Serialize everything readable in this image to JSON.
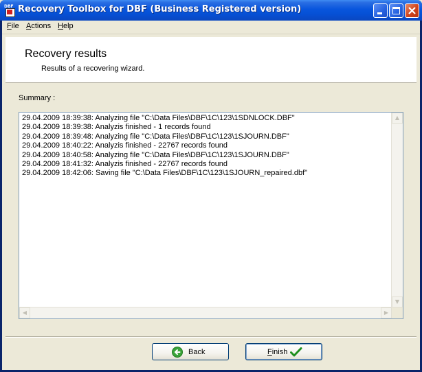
{
  "window": {
    "title": "Recovery Toolbox for DBF (Business Registered version)",
    "icon_label": "DBF",
    "controls": [
      "minimize-icon",
      "maximize-icon",
      "close-icon"
    ]
  },
  "menu": {
    "items": [
      {
        "label": "File",
        "accel": "F",
        "rest": "ile"
      },
      {
        "label": "Actions",
        "accel": "A",
        "rest": "ctions"
      },
      {
        "label": "Help",
        "accel": "H",
        "rest": "elp"
      }
    ]
  },
  "header": {
    "title": "Recovery results",
    "subtitle": "Results of a recovering wizard."
  },
  "summary": {
    "label": "Summary :",
    "log": [
      "29.04.2009 18:39:38: Analyzing file \"C:\\Data Files\\DBF\\1C\\123\\1SDNLOCK.DBF\"",
      "29.04.2009 18:39:38: Analyzis finished - 1 records found",
      "29.04.2009 18:39:48: Analyzing file \"C:\\Data Files\\DBF\\1C\\123\\1SJOURN.DBF\"",
      "29.04.2009 18:40:22: Analyzis finished - 22767 records found",
      "29.04.2009 18:40:58: Analyzing file \"C:\\Data Files\\DBF\\1C\\123\\1SJOURN.DBF\"",
      "29.04.2009 18:41:32: Analyzis finished - 22767 records found",
      "29.04.2009 18:42:06: Saving file \"C:\\Data Files\\DBF\\1C\\123\\1SJOURN_repaired.dbf\""
    ]
  },
  "buttons": {
    "back": {
      "label": "Back",
      "icon": "back-arrow-icon"
    },
    "finish": {
      "label": "Finish",
      "accel": "F",
      "rest": "inish",
      "icon": "checkmark-icon"
    }
  },
  "colors": {
    "titlebar": "#0855dd",
    "back_icon": "#3aa33a",
    "finish_check": "#1e8f1e"
  }
}
